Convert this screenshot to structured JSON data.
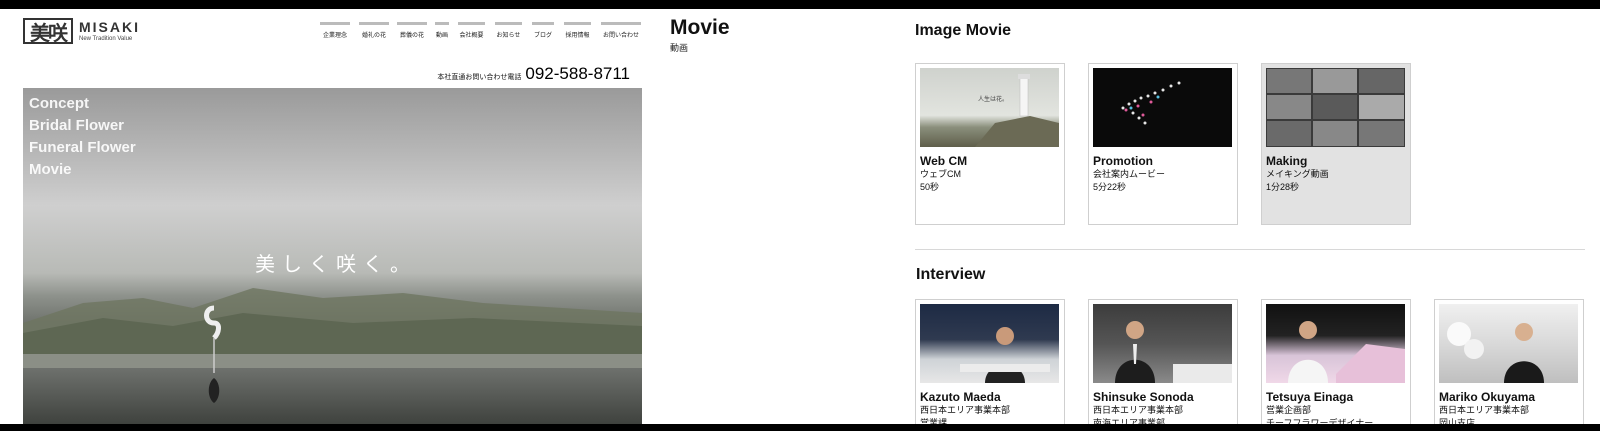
{
  "site": {
    "logo_mark": "美咲",
    "logo_name": "MISAKI",
    "logo_tagline": "New Tradition Value"
  },
  "nav": {
    "items": [
      "企業理念",
      "婚礼の花",
      "葬儀の花",
      "動画",
      "会社概要",
      "お知らせ",
      "ブログ",
      "採用情報",
      "お問い合わせ"
    ]
  },
  "contact": {
    "label": "本社直通お問い合わせ電話",
    "phone": "092-588-8711"
  },
  "hero": {
    "menu": [
      "Concept",
      "Bridal Flower",
      "Funeral Flower",
      "Movie"
    ],
    "caption": "美しく咲く。"
  },
  "page": {
    "title": "Movie",
    "subtitle": "動画"
  },
  "image_movie": {
    "heading": "Image Movie",
    "cards": [
      {
        "title": "Web CM",
        "desc": "ウェブCM",
        "duration": "50秒",
        "thumb_text": "人生は花。"
      },
      {
        "title": "Promotion",
        "desc": "会社案内ムービー",
        "duration": "5分22秒"
      },
      {
        "title": "Making",
        "desc": "メイキング動画",
        "duration": "1分28秒"
      }
    ]
  },
  "interview": {
    "heading": "Interview",
    "cards": [
      {
        "name": "Kazuto Maeda",
        "dept": "西日本エリア事業本部",
        "role": "営業課"
      },
      {
        "name": "Shinsuke Sonoda",
        "dept": "西日本エリア事業本部",
        "role": "南海エリア事業部"
      },
      {
        "name": "Tetsuya Einaga",
        "dept": "営業企画部",
        "role": "チーフフラワーデザイナー"
      },
      {
        "name": "Mariko Okuyama",
        "dept": "西日本エリア事業本部",
        "role": "岡山支店"
      }
    ]
  }
}
